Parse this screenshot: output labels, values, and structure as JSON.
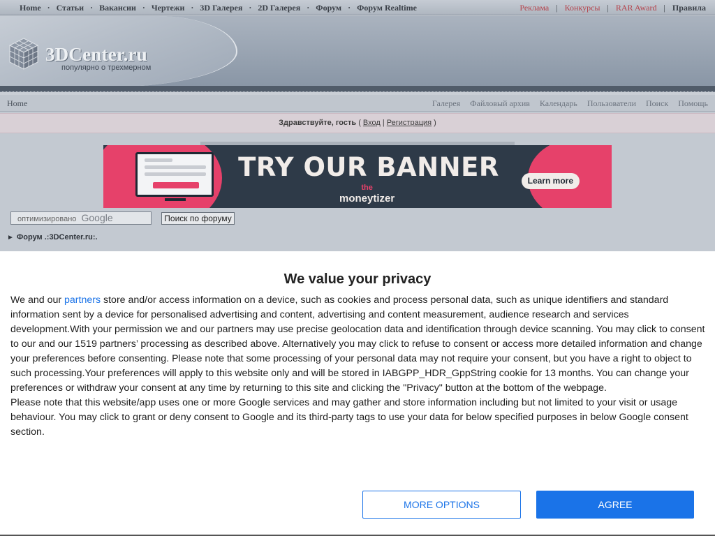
{
  "topnav": {
    "left": [
      "Home",
      "Статьи",
      "Вакансии",
      "Чертежи",
      "3D Галерея",
      "2D Галерея",
      "Форум",
      "Форум Realtime"
    ],
    "right": [
      "Реклама",
      "Конкурсы",
      "RAR Award",
      "Правила"
    ]
  },
  "header": {
    "logo_text": "3DCenter.ru",
    "tagline": "популярно о трехмерном"
  },
  "subnav": {
    "home": "Home",
    "links": [
      "Галерея",
      "Файловый архив",
      "Календарь",
      "Пользователи",
      "Поиск",
      "Помощь"
    ]
  },
  "greeting": {
    "prefix": "Здравствуйте, гость",
    "open": "(",
    "login": "Вход",
    "sep": "|",
    "register": "Регистрация",
    "close": ")"
  },
  "banner": {
    "headline": "TRY OUR BANNER",
    "brand_top": "the",
    "brand": "moneytizer",
    "cta": "Learn more"
  },
  "search": {
    "placeholder_label": "оптимизировано",
    "placeholder_brand": "Google",
    "button": "Поиск по форуму"
  },
  "breadcrumb": {
    "arrow": "►",
    "text": "Форум .:3DCenter.ru:."
  },
  "privacy": {
    "title": "We value your privacy",
    "p1_start": "We and our ",
    "p1_link": "partners",
    "p1_rest": " store and/or access information on a device, such as cookies and process personal data, such as unique identifiers and standard information sent by a device for personalised advertising and content, advertising and content measurement, audience research and services development.With your permission we and our partners may use precise geolocation data and identification through device scanning. You may click to consent to our and our 1519 partners’ processing as described above. Alternatively you may click to refuse to consent or access more detailed information and change your preferences before consenting. Please note that some processing of your personal data may not require your consent, but you have a right to object to such processing.Your preferences will apply to this website only and will be stored in IABGPP_HDR_GppString cookie for 13 months. You can change your preferences or withdraw your consent at any time by returning to this site and clicking the \"Privacy\" button at the bottom of the webpage.",
    "p2": "Please note that this website/app uses one or more Google services and may gather and store information including but not limited to your visit or usage behaviour. You may click to grant or deny consent to Google and its third-party tags to use your data for below specified purposes in below Google consent section.",
    "more_options": "MORE OPTIONS",
    "agree": "AGREE"
  },
  "colors": {
    "accent_link": "#1a73e8",
    "top_right_links": "#b5424b",
    "banner_pink": "#e6416a",
    "banner_dark": "#2e3a48"
  }
}
